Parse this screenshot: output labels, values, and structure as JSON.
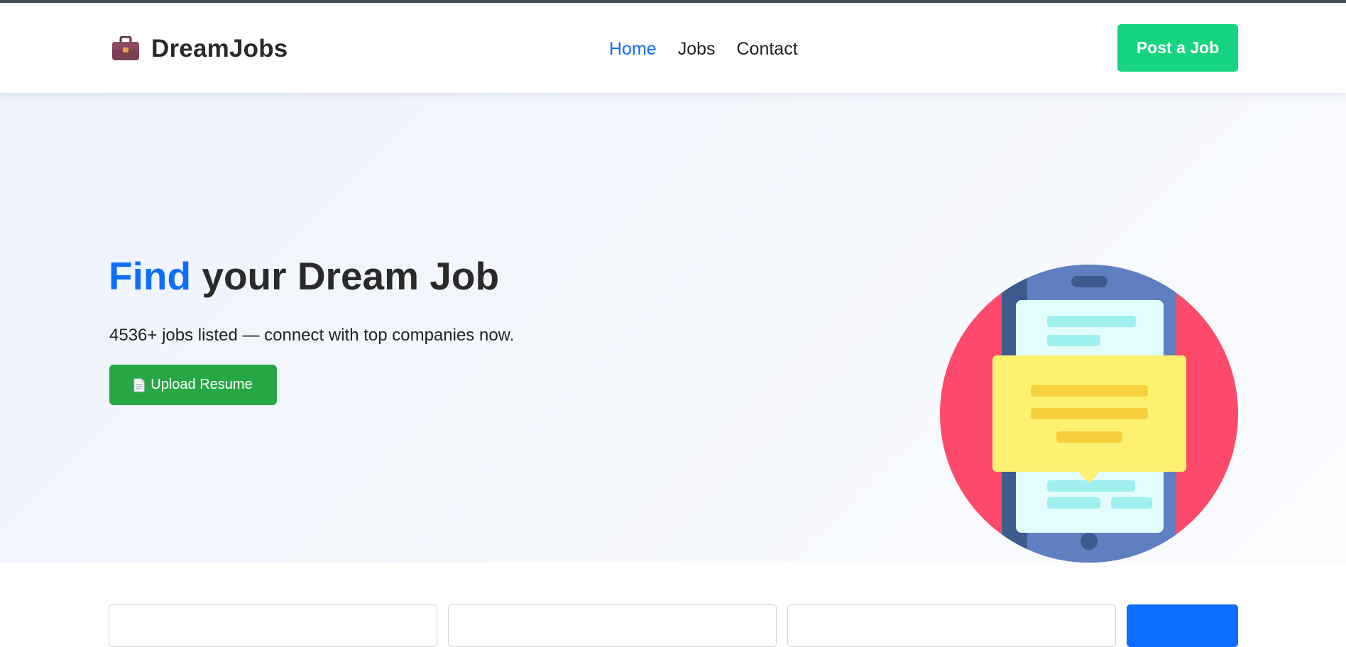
{
  "brand": {
    "name": "DreamJobs",
    "icon": "briefcase-icon"
  },
  "nav": {
    "items": [
      {
        "label": "Home",
        "active": true
      },
      {
        "label": "Jobs",
        "active": false
      },
      {
        "label": "Contact",
        "active": false
      }
    ]
  },
  "header": {
    "post_job_label": "Post a Job"
  },
  "hero": {
    "title_accent": "Find",
    "title_rest": "your Dream Job",
    "subtitle": "4536+ jobs listed — connect with top companies now.",
    "upload_label": "Upload Resume",
    "upload_icon": "document-icon",
    "illustration": "phone-chat-illustration"
  },
  "colors": {
    "primary": "#0d6efd",
    "post_button": "#16d480",
    "upload_button": "#28a745",
    "heading": "#2a2a2a"
  }
}
